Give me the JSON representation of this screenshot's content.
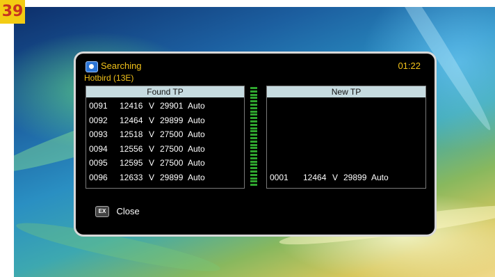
{
  "page_number": "39",
  "osd": {
    "title": "Searching",
    "time": "01:22",
    "satellite": "Hotbird (13E)",
    "found_tp": {
      "header": "Found TP",
      "rows": [
        {
          "id": "0091",
          "freq": "12416",
          "pol": "V",
          "sr": "29901",
          "fec": "Auto"
        },
        {
          "id": "0092",
          "freq": "12464",
          "pol": "V",
          "sr": "29899",
          "fec": "Auto"
        },
        {
          "id": "0093",
          "freq": "12518",
          "pol": "V",
          "sr": "27500",
          "fec": "Auto"
        },
        {
          "id": "0094",
          "freq": "12556",
          "pol": "V",
          "sr": "27500",
          "fec": "Auto"
        },
        {
          "id": "0095",
          "freq": "12595",
          "pol": "V",
          "sr": "27500",
          "fec": "Auto"
        },
        {
          "id": "0096",
          "freq": "12633",
          "pol": "V",
          "sr": "29899",
          "fec": "Auto"
        }
      ]
    },
    "new_tp": {
      "header": "New TP",
      "rows": [
        {
          "id": "0001",
          "freq": "12464",
          "pol": "V",
          "sr": "29899",
          "fec": "Auto"
        }
      ]
    },
    "footer": {
      "key_label": "EX",
      "close_label": "Close"
    },
    "colors": {
      "title": "#f2c21a",
      "panel_header": "#c6dbe0",
      "progress": "#2fa62f"
    }
  }
}
